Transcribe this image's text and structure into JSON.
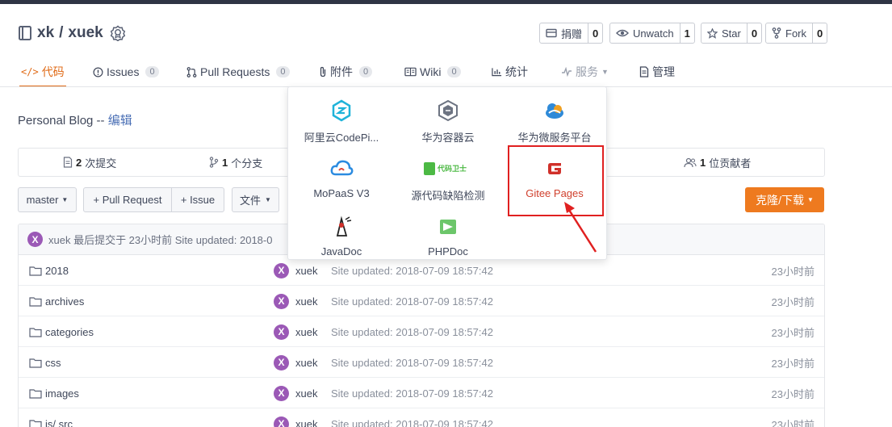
{
  "repo": {
    "owner": "xk",
    "sep": "/",
    "name": "xuek"
  },
  "actions": [
    {
      "label": "捐赠",
      "count": "0",
      "icon": "donate-icon"
    },
    {
      "label": "Unwatch",
      "count": "1",
      "icon": "eye-icon"
    },
    {
      "label": "Star",
      "count": "0",
      "icon": "star-icon"
    },
    {
      "label": "Fork",
      "count": "0",
      "icon": "fork-icon"
    }
  ],
  "tabs": [
    {
      "label": "代码",
      "count": "",
      "icon": "code-icon"
    },
    {
      "label": "Issues",
      "count": "0",
      "icon": "issue-icon"
    },
    {
      "label": "Pull Requests",
      "count": "0",
      "icon": "pull-request-icon"
    },
    {
      "label": "附件",
      "count": "0",
      "icon": "paperclip-icon"
    },
    {
      "label": "Wiki",
      "count": "0",
      "icon": "book-icon"
    },
    {
      "label": "统计",
      "count": "",
      "icon": "bar-chart-icon"
    },
    {
      "label": "服务",
      "count": "",
      "icon": "pulse-icon"
    },
    {
      "label": "管理",
      "count": "",
      "icon": "settings-doc-icon"
    }
  ],
  "description": {
    "text": "Personal Blog -- ",
    "edit": "编辑"
  },
  "stats": {
    "commits_num": "2",
    "commits_label": "次提交",
    "branches_num": "1",
    "branches_label": "个分支",
    "contributors_num": "1",
    "contributors_label": "位贡献者"
  },
  "toolbar": {
    "branch": "master",
    "pull_request": "+ Pull Request",
    "issue": "+ Issue",
    "file": "文件",
    "clone": "克隆/下载"
  },
  "last_commit": {
    "avatar": "X",
    "text": "xuek 最后提交于 23小时前 Site updated: 2018-0"
  },
  "files": [
    {
      "name": "2018",
      "author": "xuek",
      "message": "Site updated: 2018-07-09 18:57:42",
      "time": "23小时前"
    },
    {
      "name": "archives",
      "author": "xuek",
      "message": "Site updated: 2018-07-09 18:57:42",
      "time": "23小时前"
    },
    {
      "name": "categories",
      "author": "xuek",
      "message": "Site updated: 2018-07-09 18:57:42",
      "time": "23小时前"
    },
    {
      "name": "css",
      "author": "xuek",
      "message": "Site updated: 2018-07-09 18:57:42",
      "time": "23小时前"
    },
    {
      "name": "images",
      "author": "xuek",
      "message": "Site updated: 2018-07-09 18:57:42",
      "time": "23小时前"
    },
    {
      "name": "js/ src",
      "author": "xuek",
      "message": "Site updated: 2018-07-09 18:57:42",
      "time": "23小时前"
    }
  ],
  "services_menu": [
    {
      "label": "阿里云CodePi...",
      "icon": "aliyun-codepipeline-icon"
    },
    {
      "label": "华为容器云",
      "icon": "huawei-container-cloud-icon"
    },
    {
      "label": "华为微服务平台",
      "icon": "huawei-microservice-icon"
    },
    {
      "label": "MoPaaS V3",
      "icon": "mopaas-cloud-icon"
    },
    {
      "label": "源代码缺陷检测",
      "icon": "code-guard-icon",
      "icon_text": "代码卫士"
    },
    {
      "label": "Gitee Pages",
      "icon": "gitee-pages-icon"
    },
    {
      "label": "JavaDoc",
      "icon": "javadoc-duke-icon"
    },
    {
      "label": "PHPDoc",
      "icon": "phpdoc-icon"
    }
  ],
  "colors": {
    "accent": "#e06a16",
    "clone_button": "#ee7a1f",
    "highlight_box": "#e02020",
    "avatar": "#9b59b6"
  }
}
